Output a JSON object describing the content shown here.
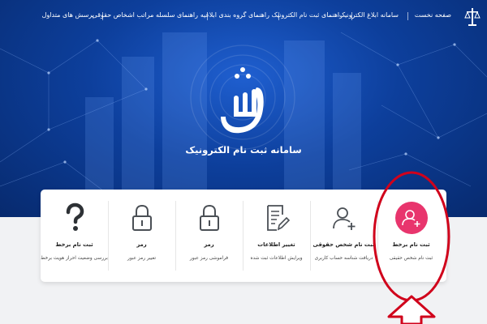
{
  "nav": {
    "items": [
      "صفحه نخست",
      "سامانه ابلاغ الکترونیک",
      "راهنمای ثبت نام الکترونیک",
      "راهنمای گروه بندی ابلاغیه",
      "راهنمای سلسله مراتب اشخاص حقوقی",
      "پرسش های متداول"
    ]
  },
  "hero": {
    "title": "سامانه ثبت نام الکترونیک"
  },
  "cards": [
    {
      "title": "ثبت نام برخط",
      "desc": "ثبت نام شخص حقیقی",
      "icon": "user-add-icon",
      "accent": "#e8356d"
    },
    {
      "title": "ثبت نام شخص حقوقی",
      "desc": "دریافت شناسه حساب کاربری",
      "icon": "user-add-icon"
    },
    {
      "title": "تغییر اطلاعات",
      "desc": "ویرایش اطلاعات ثبت شده",
      "icon": "document-edit-icon"
    },
    {
      "title": "رمز",
      "desc": "فراموشی رمز عبور",
      "icon": "lock-icon"
    },
    {
      "title": "رمز",
      "desc": "تغییر رمز عبور",
      "icon": "lock-icon"
    },
    {
      "title": "ثبت نام برخط",
      "desc": "بررسی وضعیت احراز هویت برخط",
      "icon": "question-mark-icon"
    }
  ],
  "colors": {
    "hero": "#0d3f9c",
    "highlight": "#d0021b",
    "icon_gray": "#4a4f55"
  }
}
